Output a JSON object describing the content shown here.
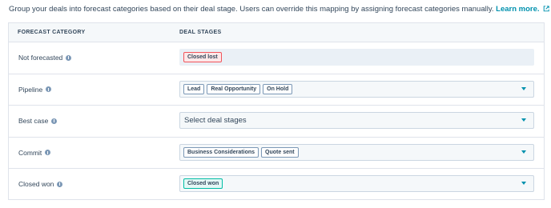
{
  "intro": {
    "text": "Group your deals into forecast categories based on their deal stage. Users can override this mapping by assigning forecast categories manually.",
    "link_label": "Learn more."
  },
  "table": {
    "headers": {
      "category": "FORECAST CATEGORY",
      "stages": "DEAL STAGES"
    },
    "rows": [
      {
        "category": "Not forecasted",
        "tags": [
          "Closed lost"
        ],
        "tag_style": "red",
        "disabled": true
      },
      {
        "category": "Pipeline",
        "tags": [
          "Lead",
          "Real Opportunity",
          "On Hold"
        ],
        "tag_style": "default",
        "disabled": false
      },
      {
        "category": "Best case",
        "tags": [],
        "placeholder": "Select deal stages",
        "disabled": false
      },
      {
        "category": "Commit",
        "tags": [
          "Business Considerations",
          "Quote sent"
        ],
        "tag_style": "default",
        "disabled": false
      },
      {
        "category": "Closed won",
        "tags": [
          "Closed won"
        ],
        "tag_style": "teal",
        "disabled": false
      }
    ]
  },
  "colors": {
    "accent": "#0091ae",
    "text": "#33475b",
    "border": "#dfe3eb",
    "info_icon": "#7c98b6",
    "lost_tag_border": "#f2545b",
    "won_tag_border": "#00bda5"
  },
  "icons": {
    "external_link": "external-link-icon",
    "info": "info-icon",
    "dropdown": "caret-down-icon"
  }
}
